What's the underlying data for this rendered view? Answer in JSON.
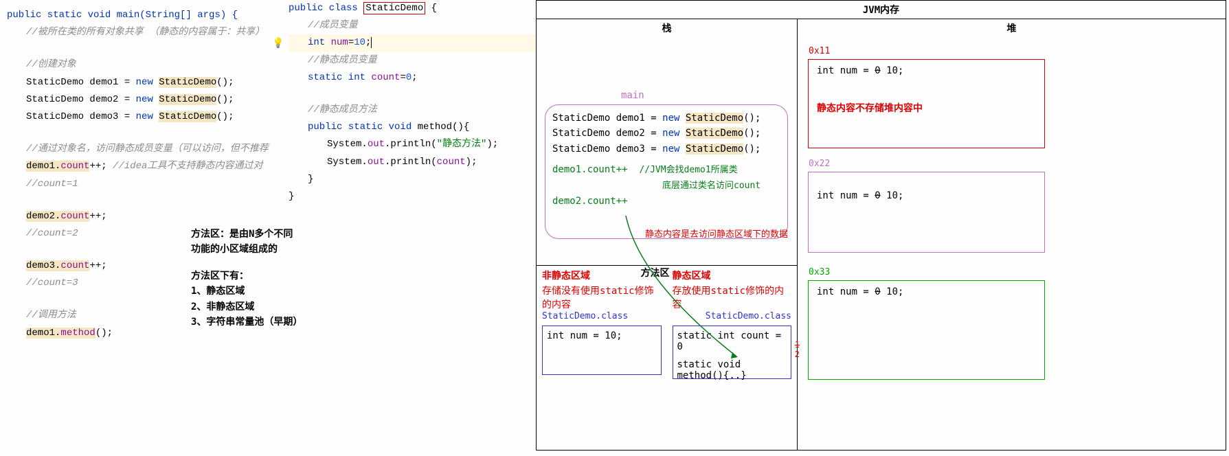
{
  "left": {
    "l1": "public static void main(String[] args) {",
    "l2": "//被所在类的所有对象共享 （静态的内容属于：共享）",
    "l3": "//创建对象",
    "l4a": "StaticDemo demo1 = ",
    "l4b": "new ",
    "l4c": "StaticDemo",
    "l4d": "();",
    "l5a": "StaticDemo demo2 = ",
    "l5b": "new ",
    "l5c": "StaticDemo",
    "l5d": "();",
    "l6a": "StaticDemo demo3 = ",
    "l6b": "new ",
    "l6c": "StaticDemo",
    "l6d": "();",
    "l7": "//通过对象名，访问静态成员变量（可以访问，但不推荐",
    "l8a": "demo1.",
    "l8b": "count",
    "l8c": "++; ",
    "l8d": "//idea工具不支持静态内容通过对",
    "l9": "//count=1",
    "l10a": "demo2.",
    "l10b": "count",
    "l10c": "++;",
    "l11": "//count=2",
    "l12a": "demo3.",
    "l12b": "count",
    "l12c": "++;",
    "l13": "//count=3",
    "l14": "//调用方法",
    "l15a": "demo1.",
    "l15b": "method",
    "l15c": "();"
  },
  "mid": {
    "m1a": "public class ",
    "m1b": "StaticDemo",
    "m1c": " {",
    "m2": "//成员变量",
    "m3a": "int ",
    "m3b": "num",
    "m3c": "=",
    "m3d": "10",
    "m3e": ";",
    "m4": "//静态成员变量",
    "m5a": "static int ",
    "m5b": "count",
    "m5c": "=",
    "m5d": "0",
    "m5e": ";",
    "m6": "//静态成员方法",
    "m7a": "public static void ",
    "m7b": "method",
    "m7c": "(){",
    "m8a": "System.",
    "m8b": "out",
    "m8c": ".println(",
    "m8d": "\"静态方法\"",
    "m8e": ");",
    "m9a": "System.",
    "m9b": "out",
    "m9c": ".println(",
    "m9d": "count",
    "m9e": ");",
    "m10": "}",
    "m11": "}"
  },
  "notes": {
    "n1": "方法区：是由N多个不同功能的小区域组成的",
    "n2": "方法区下有：",
    "n3": "1、静态区域",
    "n4": "2、非静态区域",
    "n5": "3、字符串常量池（早期）"
  },
  "jvm": {
    "title": "JVM内存",
    "stack": "栈",
    "heap": "堆",
    "main_label": "main",
    "s1a": "StaticDemo demo1 = ",
    "s1b": "new ",
    "s1c": "StaticDemo",
    "s1d": "();",
    "s2a": "StaticDemo demo2 = ",
    "s2b": "new ",
    "s2c": "StaticDemo",
    "s2d": "();",
    "s3a": "StaticDemo demo3 = ",
    "s3b": "new ",
    "s3c": "StaticDemo",
    "s3d": "();",
    "s4": "demo1.count++",
    "s4note1": "//JVM会找demo1所属类",
    "s4note2": "底层通过类名访问count",
    "s5": "demo2.count++",
    "s5note": "静态内容是去访问静态区域下的数据",
    "ma_title": "方法区",
    "ma_left_head": "非静态区域",
    "ma_left_body": "存储没有使用static修饰的内容",
    "ma_right_head": "静态区域",
    "ma_right_body": "存放使用static修饰的内容",
    "class_label": "StaticDemo.class",
    "box_left": "int num = 10;",
    "box_right1": "static int count = 0",
    "box_right2": "static void method(){..}",
    "strike1": "1",
    "strike2": "2",
    "addr1": "0x11",
    "addr2": "0x22",
    "addr3": "0x33",
    "heap_line_a": "int num = ",
    "heap_line_b": "0",
    "heap_line_c": " 10;",
    "heap_note": "静态内容不存储堆内容中"
  }
}
